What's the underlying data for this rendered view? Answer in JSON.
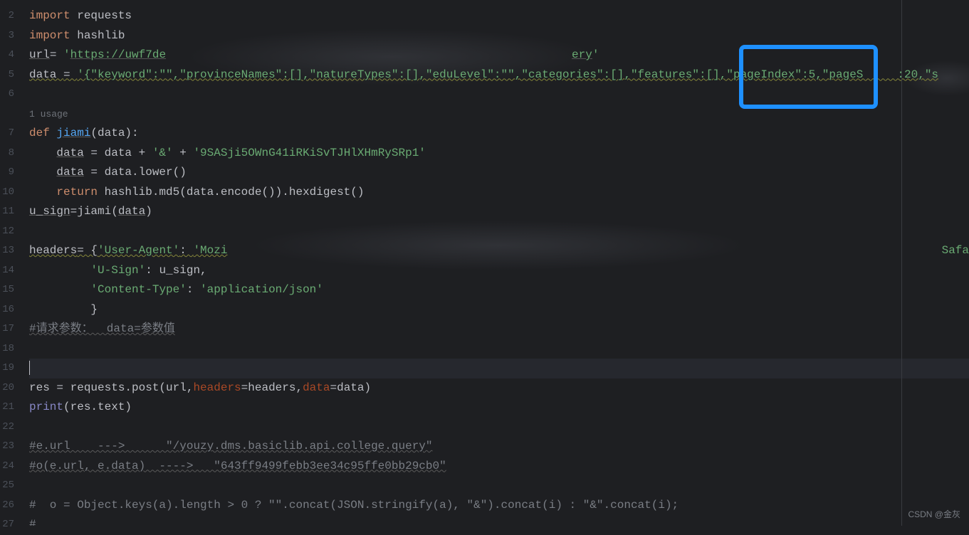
{
  "gutter": {
    "lines": [
      "2",
      "3",
      "4",
      "5",
      "6",
      "",
      "7",
      "8",
      "9",
      "10",
      "11",
      "12",
      "13",
      "14",
      "15",
      "16",
      "17",
      "18",
      "19",
      "20",
      "21",
      "22",
      "23",
      "24",
      "25",
      "26",
      "27"
    ]
  },
  "usage": {
    "text": "1 usage"
  },
  "code": {
    "l2": {
      "kw": "import",
      "mod": " requests"
    },
    "l3": {
      "kw": "import",
      "mod": " hashlib"
    },
    "l4": {
      "var": "url",
      "eq": "= ",
      "q1": "'",
      "link": "https://uwf7de",
      "tail": "ery",
      "q2": "'"
    },
    "l5": {
      "var": "data ",
      "eq": "= ",
      "str": "'{\"keyword\":\"\",\"provinceNames\":[],\"natureTypes\":[],\"eduLevel\":\"\",\"categories\":[],\"features\":[],\"pageIndex\":5,\"pageS     :20,\"s"
    },
    "l7": {
      "kw": "def ",
      "fn": "jiami",
      "sig": "(data):"
    },
    "l8": {
      "indent": "    ",
      "var": "data",
      "rest1": " = data + ",
      "s1": "'&'",
      "plus": " + ",
      "s2": "'9SASji5OWnG41iRKiSvTJHlXHmRySRp1'"
    },
    "l9": {
      "indent": "    ",
      "var": "data",
      "rest": " = data.lower()"
    },
    "l10": {
      "indent": "    ",
      "kw": "return",
      "rest": " hashlib.md5(data.encode()).hexdigest()"
    },
    "l11": {
      "var": "u_sign",
      "rest": "=jiami(",
      "arg": "data",
      "close": ")"
    },
    "l13": {
      "var": "headers",
      "eq": "= {",
      "k1": "'User-Agent'",
      "colon": ": ",
      "v1": "'Mozi",
      "safa": "Safa"
    },
    "l14": {
      "indent": "         ",
      "k": "'U-Sign'",
      "rest": ": u_sign,"
    },
    "l15": {
      "indent": "         ",
      "k": "'Content-Type'",
      "colon": ": ",
      "v": "'application/json'"
    },
    "l16": {
      "indent": "         ",
      "brace": "}"
    },
    "l17": {
      "comment": "#请求参数：  data=参数值"
    },
    "l20": {
      "pre": "res = requests.post(url,",
      "p1": "headers",
      "mid": "=headers,",
      "p2": "data",
      "post": "=data)"
    },
    "l21": {
      "fn": "print",
      "rest": "(res.text)"
    },
    "l23": {
      "comment": "#e.url    --->      \"/youzy.dms.basiclib.api.college.query\""
    },
    "l24": {
      "comment": "#o(e.url, e.data)  ---->   \"643ff9499febb3ee34c95ffe0bb29cb0\""
    },
    "l26": {
      "comment": "#  o = Object.keys(a).length > 0 ? \"\".concat(JSON.stringify(a), \"&\").concat(i) : \"&\".concat(i);"
    },
    "l27": {
      "comment": "#"
    }
  },
  "watermark": "CSDN @金灰"
}
